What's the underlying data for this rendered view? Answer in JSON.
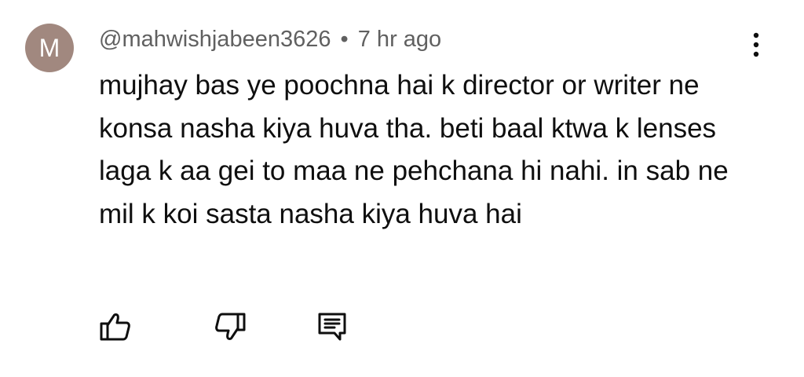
{
  "comment": {
    "avatar_initial": "M",
    "avatar_color": "#a1887f",
    "author": "@mahwishjabeen3626",
    "separator": "•",
    "time": "7 hr ago",
    "text": "mujhay bas ye poochna hai k director or writer ne konsa nasha kiya huva tha. beti baal ktwa k lenses laga k aa gei to maa ne pehchana hi nahi. in sab ne mil k koi sasta nasha kiya huva hai"
  },
  "icons": {
    "menu": "more-vert-icon",
    "like": "thumb-up-icon",
    "dislike": "thumb-down-icon",
    "reply": "comment-reply-icon"
  },
  "colors": {
    "meta_text": "#606060",
    "body_text": "#0f0f0f",
    "icon": "#0f0f0f"
  }
}
